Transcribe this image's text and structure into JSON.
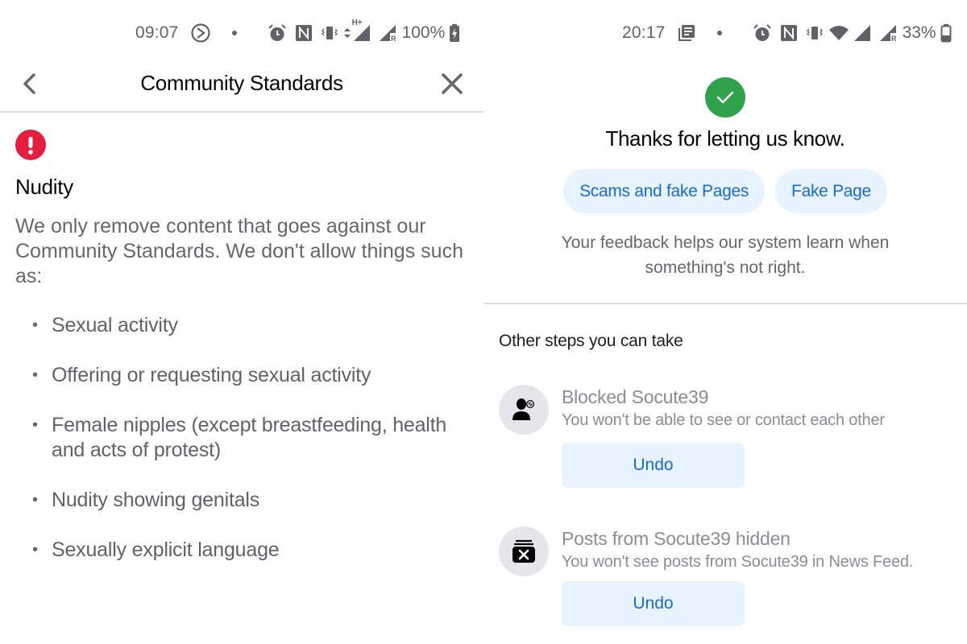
{
  "left_screen": {
    "status_bar": {
      "time": "09:07",
      "icons": [
        "media-cast-icon",
        "notification-dot",
        "alarm-icon",
        "nfc-icon",
        "vibrate-icon",
        "data-arrows-icon",
        "signal-hplus-icon",
        "signal-roaming-icon"
      ],
      "network_label": "H+",
      "battery_percent": "100%",
      "battery_state": "charging"
    },
    "header": {
      "title": "Community Standards",
      "back_icon": "chevron-left-icon",
      "close_icon": "close-icon"
    },
    "alert_icon": "exclamation-icon",
    "section_title": "Nudity",
    "intro": "We only remove content that goes against our Community Standards. We don't allow things such as:",
    "rules": [
      "Sexual activity",
      "Offering or requesting sexual activity",
      "Female nipples (except breastfeeding, health and acts of protest)",
      "Nudity showing genitals",
      "Sexually explicit language"
    ]
  },
  "right_screen": {
    "status_bar": {
      "time": "20:17",
      "icons": [
        "news-icon",
        "notification-dot",
        "alarm-icon",
        "nfc-icon",
        "vibrate-icon",
        "wifi-icon",
        "signal-icon",
        "signal-roaming-icon"
      ],
      "battery_percent": "33%",
      "battery_state": "discharging"
    },
    "confirmation_icon": "checkmark-icon",
    "thanks": "Thanks for letting us know.",
    "chips": [
      "Scams and fake Pages",
      "Fake Page"
    ],
    "feedback": "Your feedback helps our system learn when something's not right.",
    "other_steps_title": "Other steps you can take",
    "steps": [
      {
        "icon": "blocked-user-icon",
        "title": "Blocked Socute39",
        "description": "You won't be able to see or contact each other",
        "button": "Undo"
      },
      {
        "icon": "hidden-posts-icon",
        "title": "Posts from Socute39 hidden",
        "description": "You won't see posts from Socute39 in News Feed.",
        "button": "Undo"
      }
    ]
  },
  "colors": {
    "alert_red": "#e41e3f",
    "success_green": "#31a24c",
    "link_blue": "#1b6ac9",
    "chip_bg": "#e7f3ff",
    "secondary_text": "#65676b"
  }
}
